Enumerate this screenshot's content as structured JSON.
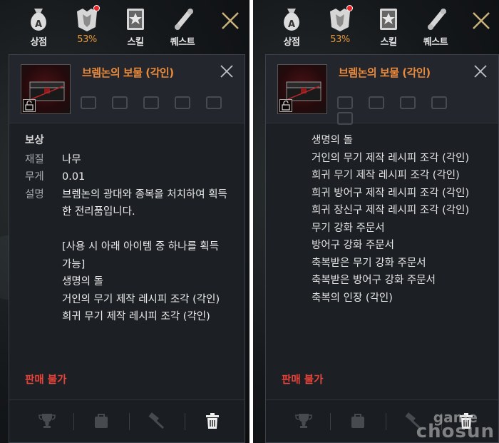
{
  "menu": {
    "shop_label": "상점",
    "inventory_percent": "53%",
    "skill_label": "스킬",
    "quest_label": "퀘스트"
  },
  "item": {
    "title": "브렘논의 보물 (각인)",
    "section_reward": "보상",
    "props": [
      {
        "key": "재질",
        "value": "나무"
      },
      {
        "key": "무게",
        "value": "0.01"
      },
      {
        "key": "설명",
        "value": "브렘논의 광대와 종복을 처치하여 획득한 전리품입니다."
      }
    ],
    "usage_note": "[사용 시 아래 아이템 중 하나를 획득 가능]",
    "rewards_left": [
      "생명의 돌",
      "거인의 무기 제작 레시피 조각 (각인)",
      "희귀 무기 제작 레시피 조각 (각인)"
    ],
    "rewards_right": [
      "생명의 돌",
      "거인의 무기 제작 레시피 조각 (각인)",
      "희귀 무기 제작 레시피 조각 (각인)",
      "희귀 방어구 제작 레시피 조각 (각인)",
      "희귀 장신구 제작 레시피 조각 (각인)",
      "무기 강화 주문서",
      "방어구 강화 주문서",
      "축복받은 무기 강화 주문서",
      "축복받은 방어구 강화 주문서",
      "축복의 인장 (각인)"
    ],
    "not_sellable": "판매 불가"
  },
  "watermark": {
    "line1": "game",
    "line2": "chosun"
  },
  "colors": {
    "accent_orange": "#ea8a3a",
    "not_sellable_red": "#e8433a",
    "panel_bg": "#1c1f24"
  }
}
